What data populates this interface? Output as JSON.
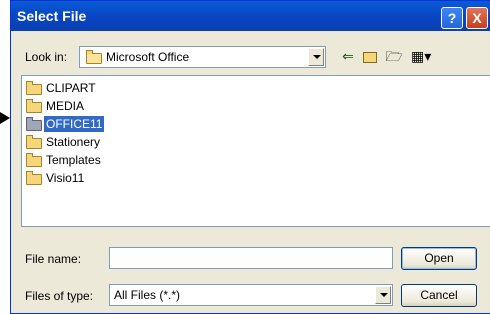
{
  "dialog": {
    "title": "Select File",
    "help_glyph": "?",
    "close_glyph": "X"
  },
  "lookin": {
    "label": "Look in:",
    "value": "Microsoft Office",
    "icons": [
      "folder-icon",
      "back-arrow-icon",
      "up-one-level-icon",
      "new-folder-icon",
      "views-menu-icon"
    ]
  },
  "files": {
    "items": [
      {
        "label": "CLIPART",
        "selected": false
      },
      {
        "label": "MEDIA",
        "selected": false
      },
      {
        "label": "OFFICE11",
        "selected": true
      },
      {
        "label": "Stationery",
        "selected": false
      },
      {
        "label": "Templates",
        "selected": false
      },
      {
        "label": "Visio11",
        "selected": false
      }
    ]
  },
  "filename": {
    "label": "File name:",
    "value": ""
  },
  "filetype": {
    "label": "Files of type:",
    "value": "All Files (*.*)"
  },
  "buttons": {
    "open": "Open",
    "cancel": "Cancel"
  },
  "colors": {
    "titlebar": "#0846c4",
    "dialog_bg": "#ece9d8",
    "selection": "#316ac5"
  }
}
